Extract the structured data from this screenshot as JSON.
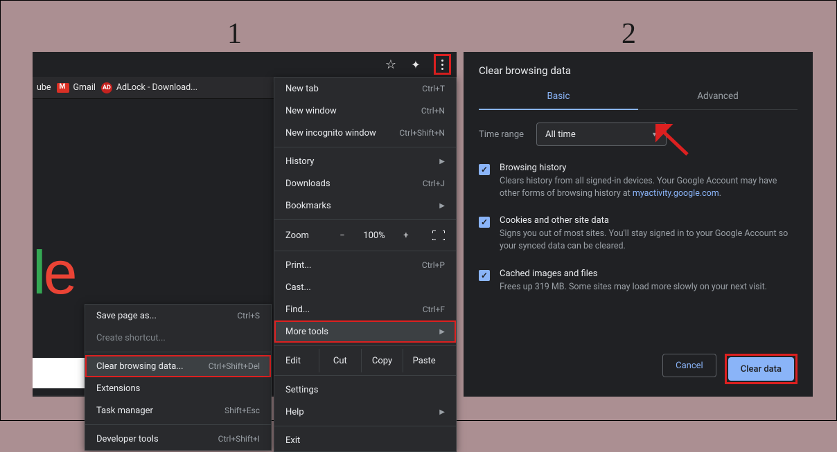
{
  "steps": {
    "one": "1",
    "two": "2"
  },
  "panel1": {
    "bookmarks": {
      "ube": "ube",
      "gmail": "Gmail",
      "adlock": "AdLock - Download..."
    },
    "mainMenu": {
      "newTab": {
        "label": "New tab",
        "shortcut": "Ctrl+T"
      },
      "newWindow": {
        "label": "New window",
        "shortcut": "Ctrl+N"
      },
      "newIncognito": {
        "label": "New incognito window",
        "shortcut": "Ctrl+Shift+N"
      },
      "history": {
        "label": "History"
      },
      "downloads": {
        "label": "Downloads",
        "shortcut": "Ctrl+J"
      },
      "bookmarks": {
        "label": "Bookmarks"
      },
      "zoom": {
        "label": "Zoom",
        "minus": "−",
        "value": "100%",
        "plus": "+"
      },
      "print": {
        "label": "Print...",
        "shortcut": "Ctrl+P"
      },
      "cast": {
        "label": "Cast..."
      },
      "find": {
        "label": "Find...",
        "shortcut": "Ctrl+F"
      },
      "moreTools": {
        "label": "More tools"
      },
      "edit": {
        "label": "Edit",
        "cut": "Cut",
        "copy": "Copy",
        "paste": "Paste"
      },
      "settings": {
        "label": "Settings"
      },
      "help": {
        "label": "Help"
      },
      "exit": {
        "label": "Exit"
      }
    },
    "subMenu": {
      "savePage": {
        "label": "Save page as...",
        "shortcut": "Ctrl+S"
      },
      "createShortcut": {
        "label": "Create shortcut..."
      },
      "clearBrowsing": {
        "label": "Clear browsing data...",
        "shortcut": "Ctrl+Shift+Del"
      },
      "extensions": {
        "label": "Extensions"
      },
      "taskManager": {
        "label": "Task manager",
        "shortcut": "Shift+Esc"
      },
      "devTools": {
        "label": "Developer tools",
        "shortcut": "Ctrl+Shift+I"
      }
    }
  },
  "panel2": {
    "title": "Clear browsing data",
    "tabs": {
      "basic": "Basic",
      "advanced": "Advanced"
    },
    "timeRange": {
      "label": "Time range",
      "value": "All time"
    },
    "options": {
      "browsing": {
        "title": "Browsing history",
        "desc1": "Clears history from all signed-in devices. Your Google Account may have other forms of browsing history at ",
        "link": "myactivity.google.com",
        "desc2": "."
      },
      "cookies": {
        "title": "Cookies and other site data",
        "desc": "Signs you out of most sites. You'll stay signed in to your Google Account so your synced data can be cleared."
      },
      "cached": {
        "title": "Cached images and files",
        "desc": "Frees up 319 MB. Some sites may load more slowly on your next visit."
      }
    },
    "buttons": {
      "cancel": "Cancel",
      "clear": "Clear data"
    }
  }
}
